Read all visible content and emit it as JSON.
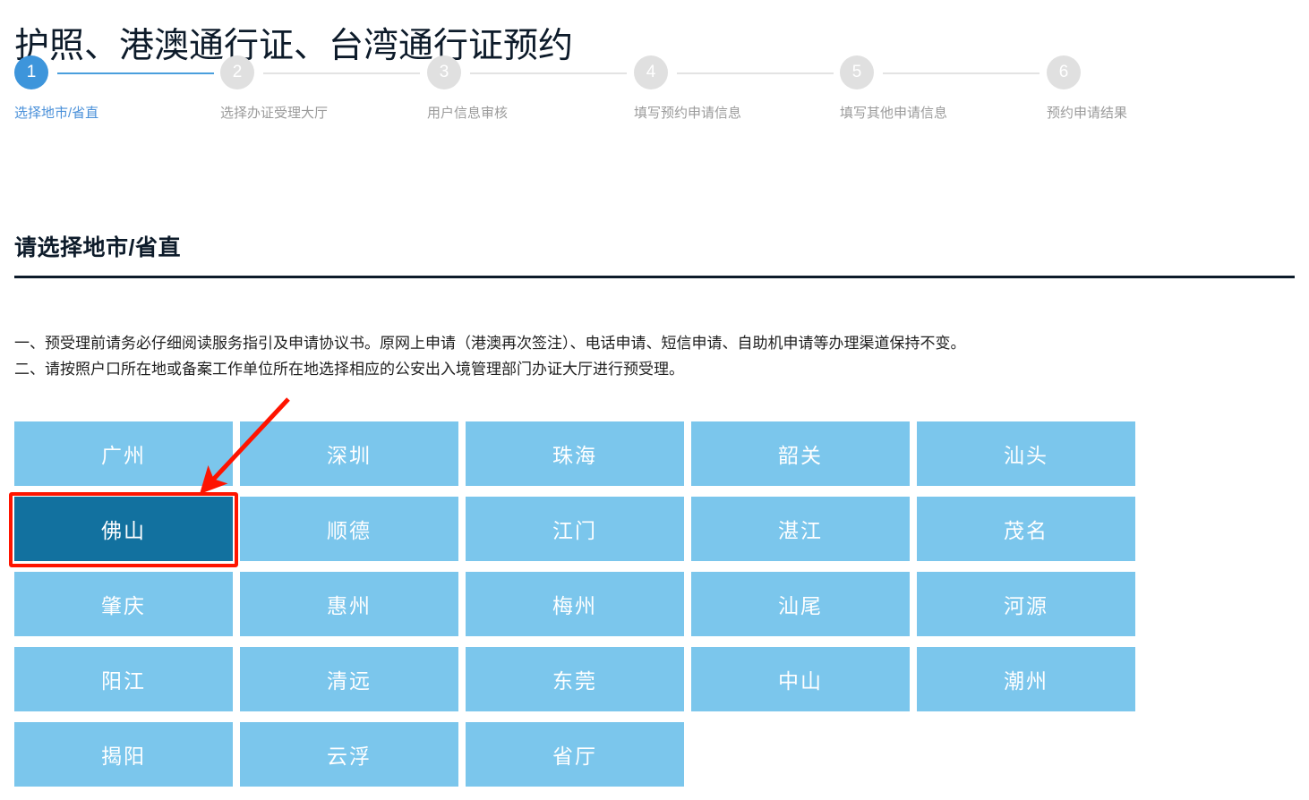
{
  "page": {
    "title": "护照、港澳通行证、台湾通行证预约"
  },
  "stepper": {
    "steps": [
      {
        "number": "1",
        "label": "选择地市/省直",
        "active": true
      },
      {
        "number": "2",
        "label": "选择办证受理大厅",
        "active": false
      },
      {
        "number": "3",
        "label": "用户信息审核",
        "active": false
      },
      {
        "number": "4",
        "label": "填写预约申请信息",
        "active": false
      },
      {
        "number": "5",
        "label": "填写其他申请信息",
        "active": false
      },
      {
        "number": "6",
        "label": "预约申请结果",
        "active": false
      }
    ]
  },
  "section": {
    "heading": "请选择地市/省直"
  },
  "notices": [
    "一、预受理前请务必仔细阅读服务指引及申请协议书。原网上申请（港澳再次签注）、电话申请、短信申请、自助机申请等办理渠道保持不变。",
    "二、请按照户口所在地或备案工作单位所在地选择相应的公安出入境管理部门办证大厅进行预受理。"
  ],
  "cities": [
    {
      "name": "广州",
      "selected": false
    },
    {
      "name": "深圳",
      "selected": false
    },
    {
      "name": "珠海",
      "selected": false
    },
    {
      "name": "韶关",
      "selected": false
    },
    {
      "name": "汕头",
      "selected": false
    },
    {
      "name": "佛山",
      "selected": true
    },
    {
      "name": "顺德",
      "selected": false
    },
    {
      "name": "江门",
      "selected": false
    },
    {
      "name": "湛江",
      "selected": false
    },
    {
      "name": "茂名",
      "selected": false
    },
    {
      "name": "肇庆",
      "selected": false
    },
    {
      "name": "惠州",
      "selected": false
    },
    {
      "name": "梅州",
      "selected": false
    },
    {
      "name": "汕尾",
      "selected": false
    },
    {
      "name": "河源",
      "selected": false
    },
    {
      "name": "阳江",
      "selected": false
    },
    {
      "name": "清远",
      "selected": false
    },
    {
      "name": "东莞",
      "selected": false
    },
    {
      "name": "中山",
      "selected": false
    },
    {
      "name": "潮州",
      "selected": false
    },
    {
      "name": "揭阳",
      "selected": false
    },
    {
      "name": "云浮",
      "selected": false
    },
    {
      "name": "省厅",
      "selected": false
    }
  ],
  "annotation": {
    "target_city": "佛山",
    "color": "#fe1400"
  },
  "colors": {
    "accent_blue": "#3d95db",
    "tile_blue": "#7bc6ec",
    "tile_selected": "#12719f",
    "heading_dark": "#0d1b2a",
    "inactive_gray": "#e0e0e0",
    "annotation_red": "#fe1400"
  }
}
